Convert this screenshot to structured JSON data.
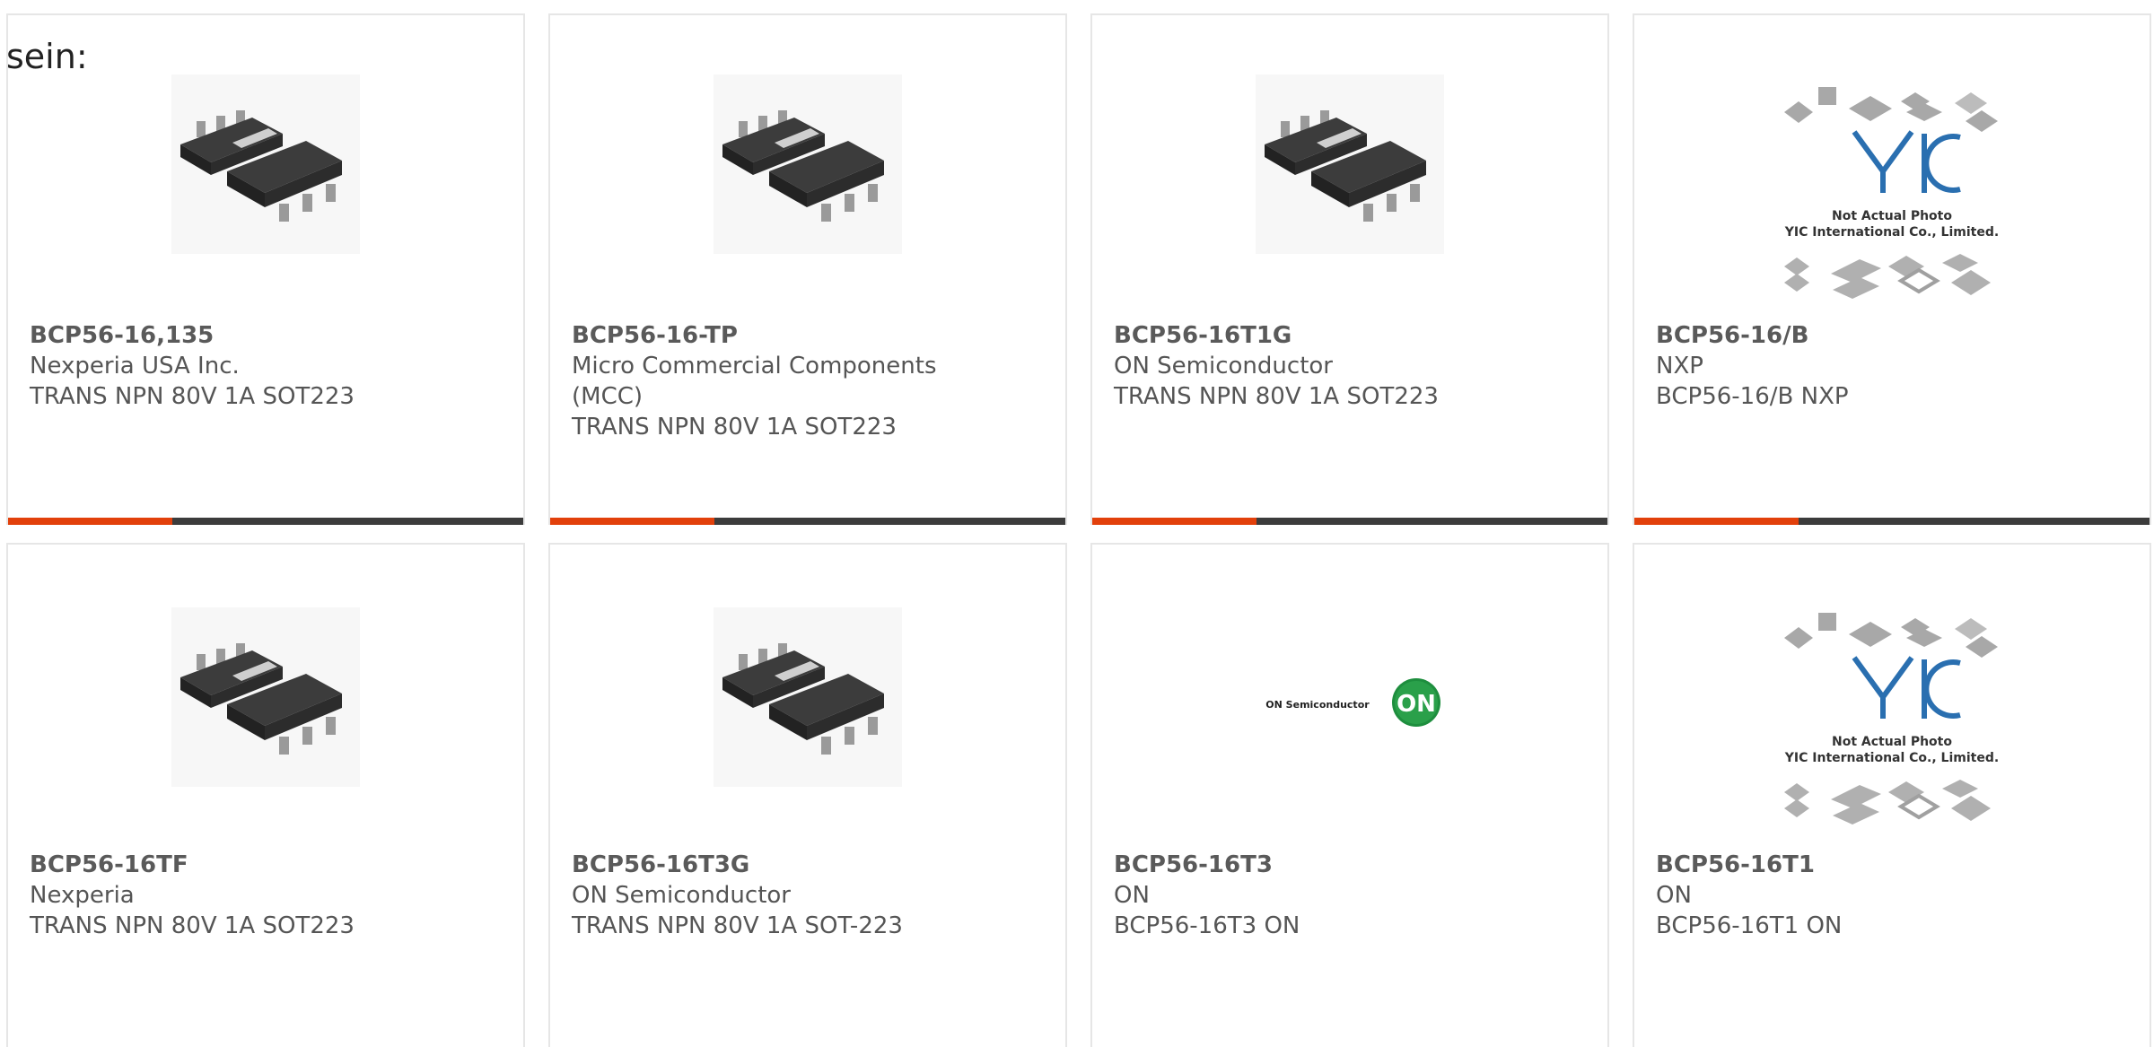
{
  "intro_text": "sein:",
  "colors": {
    "accent": "#e2400b",
    "bar": "#3c3c3c",
    "border": "#e6e6e6",
    "text": "#555555"
  },
  "products": [
    {
      "part": "BCP56-16,135",
      "mfr": "Nexperia USA Inc.",
      "desc": "TRANS NPN 80V 1A SOT223",
      "image": "sot223-package"
    },
    {
      "part": "BCP56-16-TP",
      "mfr": "Micro Commercial Components (MCC)",
      "desc": "TRANS NPN 80V 1A SOT223",
      "image": "sot223-package"
    },
    {
      "part": "BCP56-16T1G",
      "mfr": "ON Semiconductor",
      "desc": "TRANS NPN 80V 1A SOT223",
      "image": "sot223-package"
    },
    {
      "part": "BCP56-16/B",
      "mfr": "NXP",
      "desc": "BCP56-16/B NXP",
      "image": "yic-placeholder",
      "image_text": [
        "Not Actual Photo",
        "YIC International Co., Limited."
      ]
    },
    {
      "part": "BCP56-16TF",
      "mfr": "Nexperia",
      "desc": "TRANS NPN 80V 1A SOT223",
      "image": "sot223-package"
    },
    {
      "part": "BCP56-16T3G",
      "mfr": "ON Semiconductor",
      "desc": "TRANS NPN 80V 1A SOT-223",
      "image": "sot223-package"
    },
    {
      "part": "BCP56-16T3",
      "mfr": "ON",
      "desc": "BCP56-16T3 ON",
      "image": "on-semi-logo",
      "image_text": [
        "ON Semiconductor",
        "ON"
      ]
    },
    {
      "part": "BCP56-16T1",
      "mfr": "ON",
      "desc": "BCP56-16T1 ON",
      "image": "yic-placeholder",
      "image_text": [
        "Not Actual Photo",
        "YIC International Co., Limited."
      ]
    }
  ]
}
